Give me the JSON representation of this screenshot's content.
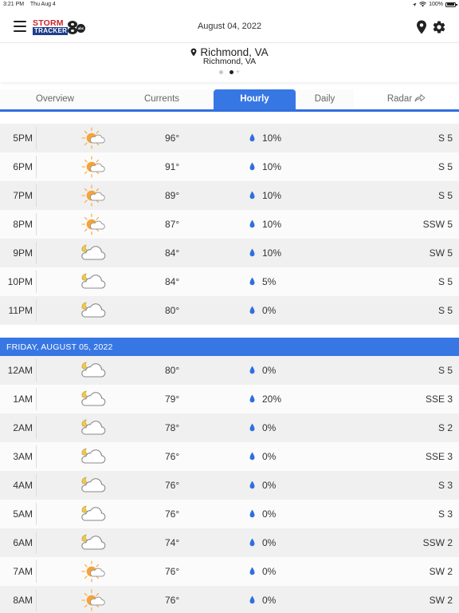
{
  "status_bar": {
    "time": "3:21 PM",
    "date": "Thu Aug 4",
    "battery": "100%",
    "icons": [
      "location-arrow-icon",
      "wifi-icon",
      "battery-icon"
    ]
  },
  "header": {
    "logo_top": "STORM",
    "logo_bottom": "TRACKER",
    "logo_badge": "abc",
    "date": "August 04, 2022",
    "icons": [
      "menu-icon",
      "location-pin-icon",
      "gear-icon"
    ]
  },
  "location": {
    "name": "Richmond, VA",
    "subtitle": "Richmond, VA",
    "pages": 2,
    "active_page": 2
  },
  "tabs": [
    {
      "label": "Overview",
      "active": false
    },
    {
      "label": "Currents",
      "active": false
    },
    {
      "label": "Hourly",
      "active": true
    },
    {
      "label": "Daily",
      "active": false
    },
    {
      "label": "Radar",
      "active": false,
      "icon": "share-arrow-icon"
    }
  ],
  "colors": {
    "accent": "#3777e4",
    "drop": "#2f6fe0",
    "sun": "#f7a335",
    "moon": "#f2c94c"
  },
  "hourly": {
    "today": [
      {
        "time": "5PM",
        "icon": "partly-sunny-icon",
        "temp": "96°",
        "precip": "10%",
        "wind": "S 5"
      },
      {
        "time": "6PM",
        "icon": "partly-sunny-icon",
        "temp": "91°",
        "precip": "10%",
        "wind": "S 5"
      },
      {
        "time": "7PM",
        "icon": "partly-sunny-icon",
        "temp": "89°",
        "precip": "10%",
        "wind": "S 5"
      },
      {
        "time": "8PM",
        "icon": "partly-sunny-icon",
        "temp": "87°",
        "precip": "10%",
        "wind": "SSW 5"
      },
      {
        "time": "9PM",
        "icon": "partly-cloudy-night-icon",
        "temp": "84°",
        "precip": "10%",
        "wind": "SW 5"
      },
      {
        "time": "10PM",
        "icon": "partly-cloudy-night-icon",
        "temp": "84°",
        "precip": "5%",
        "wind": "S 5"
      },
      {
        "time": "11PM",
        "icon": "partly-cloudy-night-icon",
        "temp": "80°",
        "precip": "0%",
        "wind": "S 5"
      }
    ],
    "next_day_label": "FRIDAY, AUGUST 05, 2022",
    "next_day": [
      {
        "time": "12AM",
        "icon": "partly-cloudy-night-icon",
        "temp": "80°",
        "precip": "0%",
        "wind": "S 5"
      },
      {
        "time": "1AM",
        "icon": "partly-cloudy-night-icon",
        "temp": "79°",
        "precip": "20%",
        "wind": "SSE 3"
      },
      {
        "time": "2AM",
        "icon": "partly-cloudy-night-icon",
        "temp": "78°",
        "precip": "0%",
        "wind": "S 2"
      },
      {
        "time": "3AM",
        "icon": "partly-cloudy-night-icon",
        "temp": "76°",
        "precip": "0%",
        "wind": "SSE 3"
      },
      {
        "time": "4AM",
        "icon": "partly-cloudy-night-icon",
        "temp": "76°",
        "precip": "0%",
        "wind": "S 3"
      },
      {
        "time": "5AM",
        "icon": "partly-cloudy-night-icon",
        "temp": "76°",
        "precip": "0%",
        "wind": "S 3"
      },
      {
        "time": "6AM",
        "icon": "partly-cloudy-night-icon",
        "temp": "74°",
        "precip": "0%",
        "wind": "SSW 2"
      },
      {
        "time": "7AM",
        "icon": "partly-sunny-icon",
        "temp": "76°",
        "precip": "0%",
        "wind": "SW 2"
      },
      {
        "time": "8AM",
        "icon": "partly-sunny-icon",
        "temp": "76°",
        "precip": "0%",
        "wind": "SW 2"
      }
    ]
  }
}
